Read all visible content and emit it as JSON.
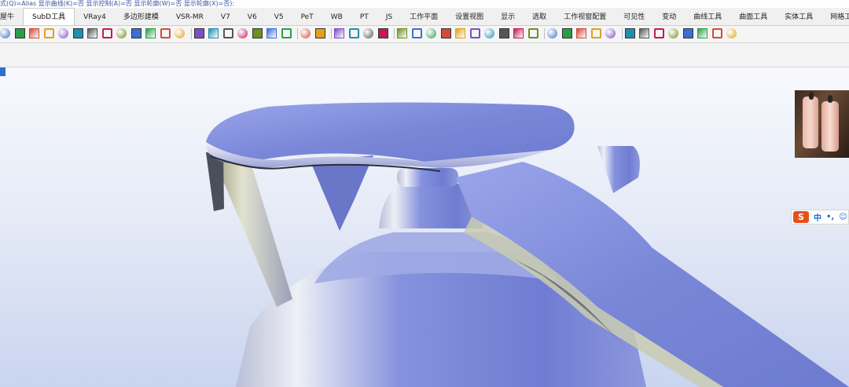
{
  "command_line": "式(Q)=Alias 显示曲线(K)=否 显示控制(A)=否 显示轮廓(W)=否 显示轮廓(X)=否):",
  "tabs": [
    "屋牛",
    "SubD工具",
    "VRay4",
    "多边形建模",
    "VSR-MR",
    "V7",
    "V6",
    "V5",
    "PeT",
    "WB",
    "PT",
    "JS",
    "工作平面",
    "设置视图",
    "显示",
    "选取",
    "工作视窗配置",
    "可见性",
    "变动",
    "曲线工具",
    "曲面工具",
    "实体工具",
    "网格工"
  ],
  "active_tab": "SubD工具",
  "toolbar_icons": [
    "sphere-icon",
    "sphere-blue-icon",
    "ellipsoid-icon",
    "torus-icon",
    "sphere-sm-icon",
    "gear-icon",
    "curve-tool-icon",
    "arrows-icon",
    "branch-icon",
    "surface-icon",
    "patch-icon",
    "transform-icon",
    "box-icon",
    "grid-select-icon",
    "bend-icon",
    "sphere-edit-icon",
    "cube-icon",
    "cube-render-icon",
    "mesh-icon",
    "mesh-grid-icon",
    "tube-icon",
    "spring-icon",
    "layer-icon",
    "frame-icon",
    "lamp-icon",
    "material-icon",
    "grid-icon",
    "bucket-icon",
    "cube-shell-icon",
    "flow-icon",
    "render-icon",
    "dots-icon",
    "globe-icon",
    "stack-icon",
    "tools-icon",
    "camera-icon",
    "sphere-rot-icon",
    "sphere-half-icon",
    "sphere-cut-icon",
    "no-icon",
    "link-icon",
    "star-icon",
    "house-icon",
    "layers-icon",
    "book-icon",
    "wave-icon",
    "image-icon",
    "arrow-icon",
    "cross-icon"
  ],
  "ime": {
    "label": "中"
  },
  "colors": {
    "accent": "#2f6ecf",
    "ime": "#e8501a",
    "surface": "#7b8ad8"
  }
}
